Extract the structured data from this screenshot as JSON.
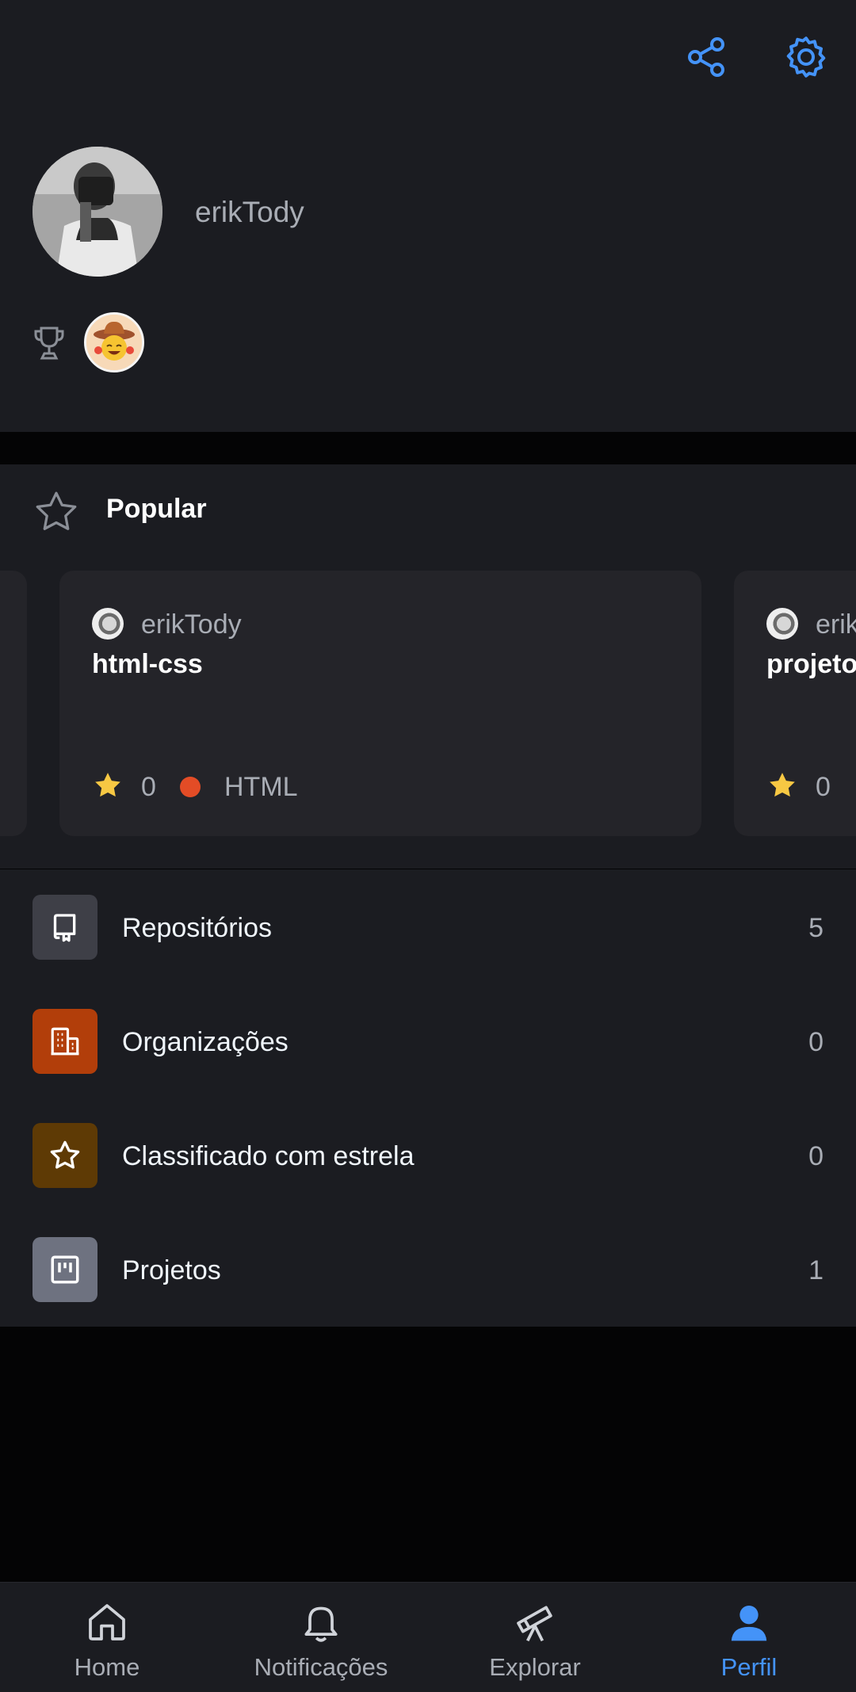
{
  "colors": {
    "accent": "#4493f8",
    "background": "#1b1c21",
    "card": "#242429",
    "muted_text": "#a9adb5",
    "html_language": "#e34c26",
    "star": "#f7c843"
  },
  "header": {
    "share_icon": "share-icon",
    "settings_icon": "gear-icon"
  },
  "profile": {
    "username": "erikTody",
    "achievements": [
      "trophy-icon",
      "cowboy-emoji-achievement"
    ]
  },
  "popular": {
    "title": "Popular",
    "cards": [
      {
        "owner": "erikTody",
        "name": "html-css",
        "stars": "0",
        "language": "HTML"
      },
      {
        "owner": "erik",
        "name": "projeto",
        "stars": "0"
      }
    ]
  },
  "stats": [
    {
      "label": "Repositórios",
      "count": "5",
      "icon": "repo-icon",
      "color": "#3e3f47"
    },
    {
      "label": "Organizações",
      "count": "0",
      "icon": "organization-icon",
      "color": "#b23e0a"
    },
    {
      "label": "Classificado com estrela",
      "count": "0",
      "icon": "star-icon",
      "color": "#5e3a05"
    },
    {
      "label": "Projetos",
      "count": "1",
      "icon": "project-icon",
      "color": "#6e7280"
    }
  ],
  "nav": {
    "items": [
      {
        "label": "Home",
        "icon": "home-icon",
        "active": false
      },
      {
        "label": "Notificações",
        "icon": "bell-icon",
        "active": false
      },
      {
        "label": "Explorar",
        "icon": "telescope-icon",
        "active": false
      },
      {
        "label": "Perfil",
        "icon": "person-icon",
        "active": true
      }
    ]
  }
}
